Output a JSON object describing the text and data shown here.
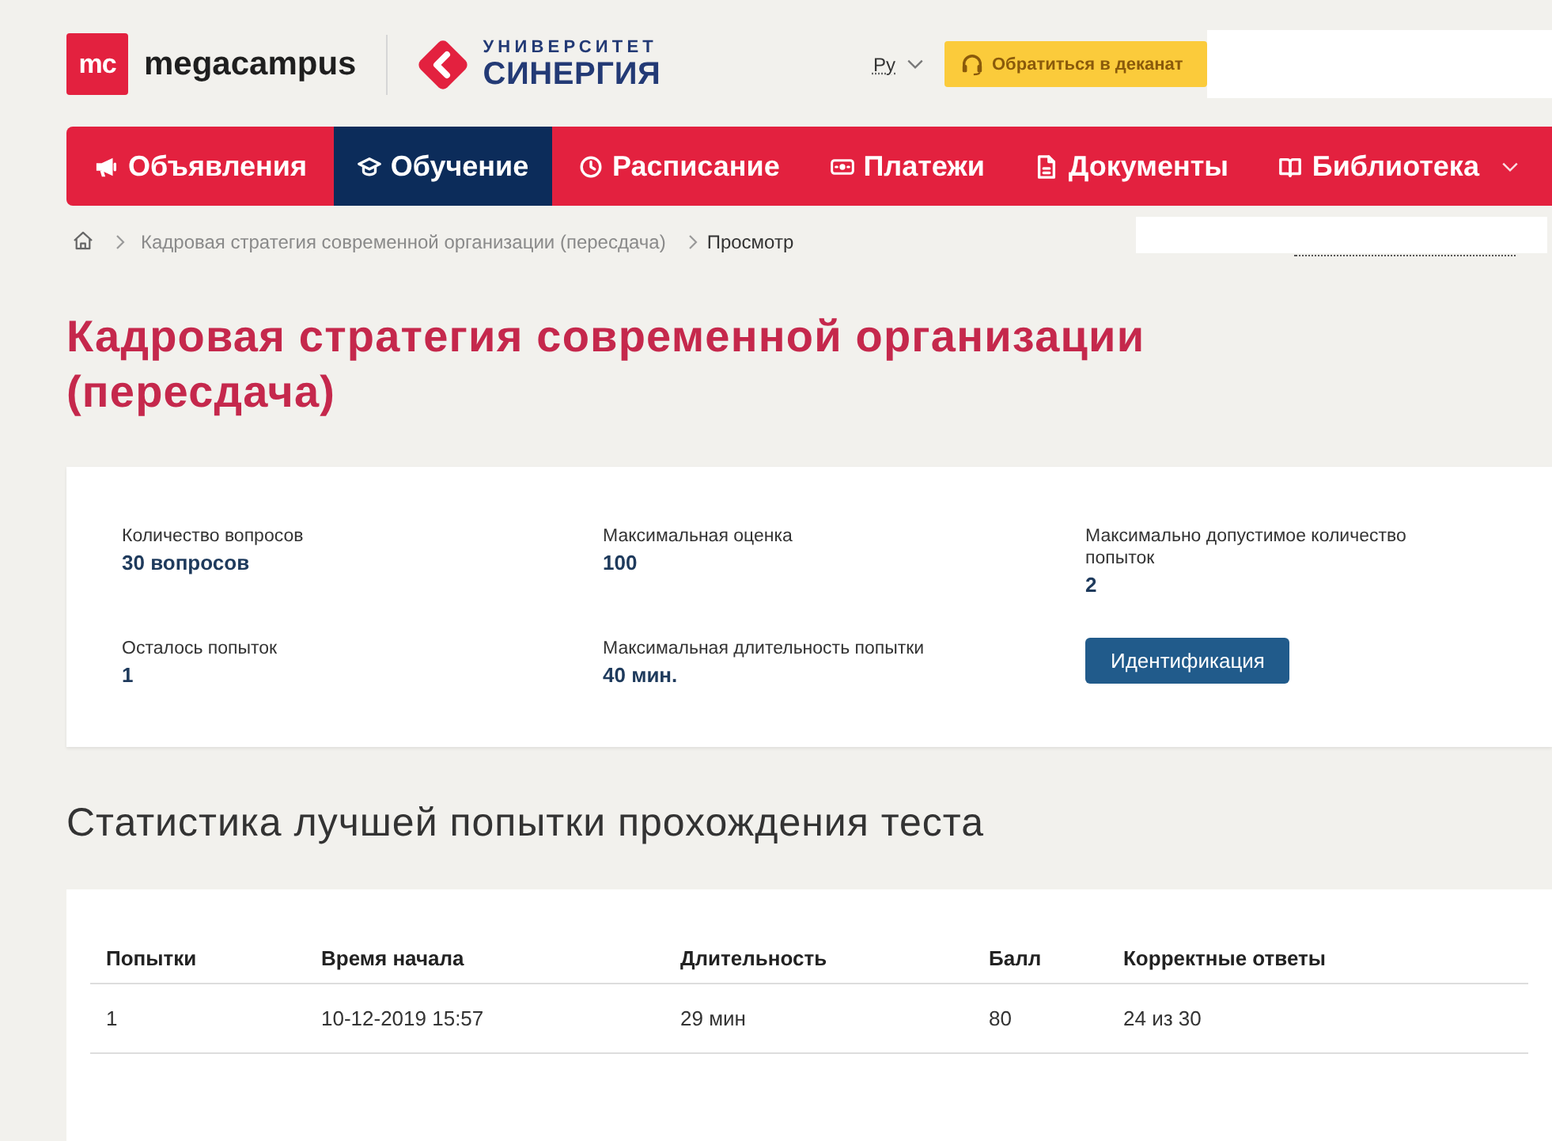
{
  "header": {
    "logo_mark": "mc",
    "brand_name": "megacampus",
    "university_logo": {
      "line_1": "УНИВЕРСИТЕТ",
      "line_2": "СИНЕРГИЯ"
    },
    "language": "Ру",
    "dean_button": "Обратиться в деканат"
  },
  "nav": [
    {
      "label": "Объявления",
      "selected": false,
      "dropdown": false
    },
    {
      "label": "Обучение",
      "selected": true,
      "dropdown": false
    },
    {
      "label": "Расписание",
      "selected": false,
      "dropdown": false
    },
    {
      "label": "Платежи",
      "selected": false,
      "dropdown": false
    },
    {
      "label": "Документы",
      "selected": false,
      "dropdown": false
    },
    {
      "label": "Библиотека",
      "selected": false,
      "dropdown": true
    }
  ],
  "breadcrumb": [
    {
      "label": "Кадровая стратегия современной организации (пересдача)",
      "current": false
    },
    {
      "label": "Просмотр",
      "current": true
    }
  ],
  "page_title": "Кадровая стратегия современной организации (пересдача)",
  "test_info": {
    "fields": [
      {
        "label": "Количество вопросов",
        "value": "30 вопросов"
      },
      {
        "label": "Максимальная оценка",
        "value": "100"
      },
      {
        "label": "Максимально допустимое количество попыток",
        "value": "2"
      },
      {
        "label": "Осталось попыток",
        "value": "1"
      },
      {
        "label": "Максимальная длительность попытки",
        "value": "40 мин."
      }
    ],
    "button": "Идентификация"
  },
  "best_attempt": {
    "title": "Статистика лучшей попытки прохождения теста",
    "table": {
      "columns": [
        "Попытки",
        "Время начала",
        "Длительность",
        "Балл",
        "Корректные ответы"
      ],
      "rows": [
        [
          "1",
          "10-12-2019 15:57",
          "29 мин",
          "80",
          "24 из 30"
        ]
      ]
    }
  }
}
